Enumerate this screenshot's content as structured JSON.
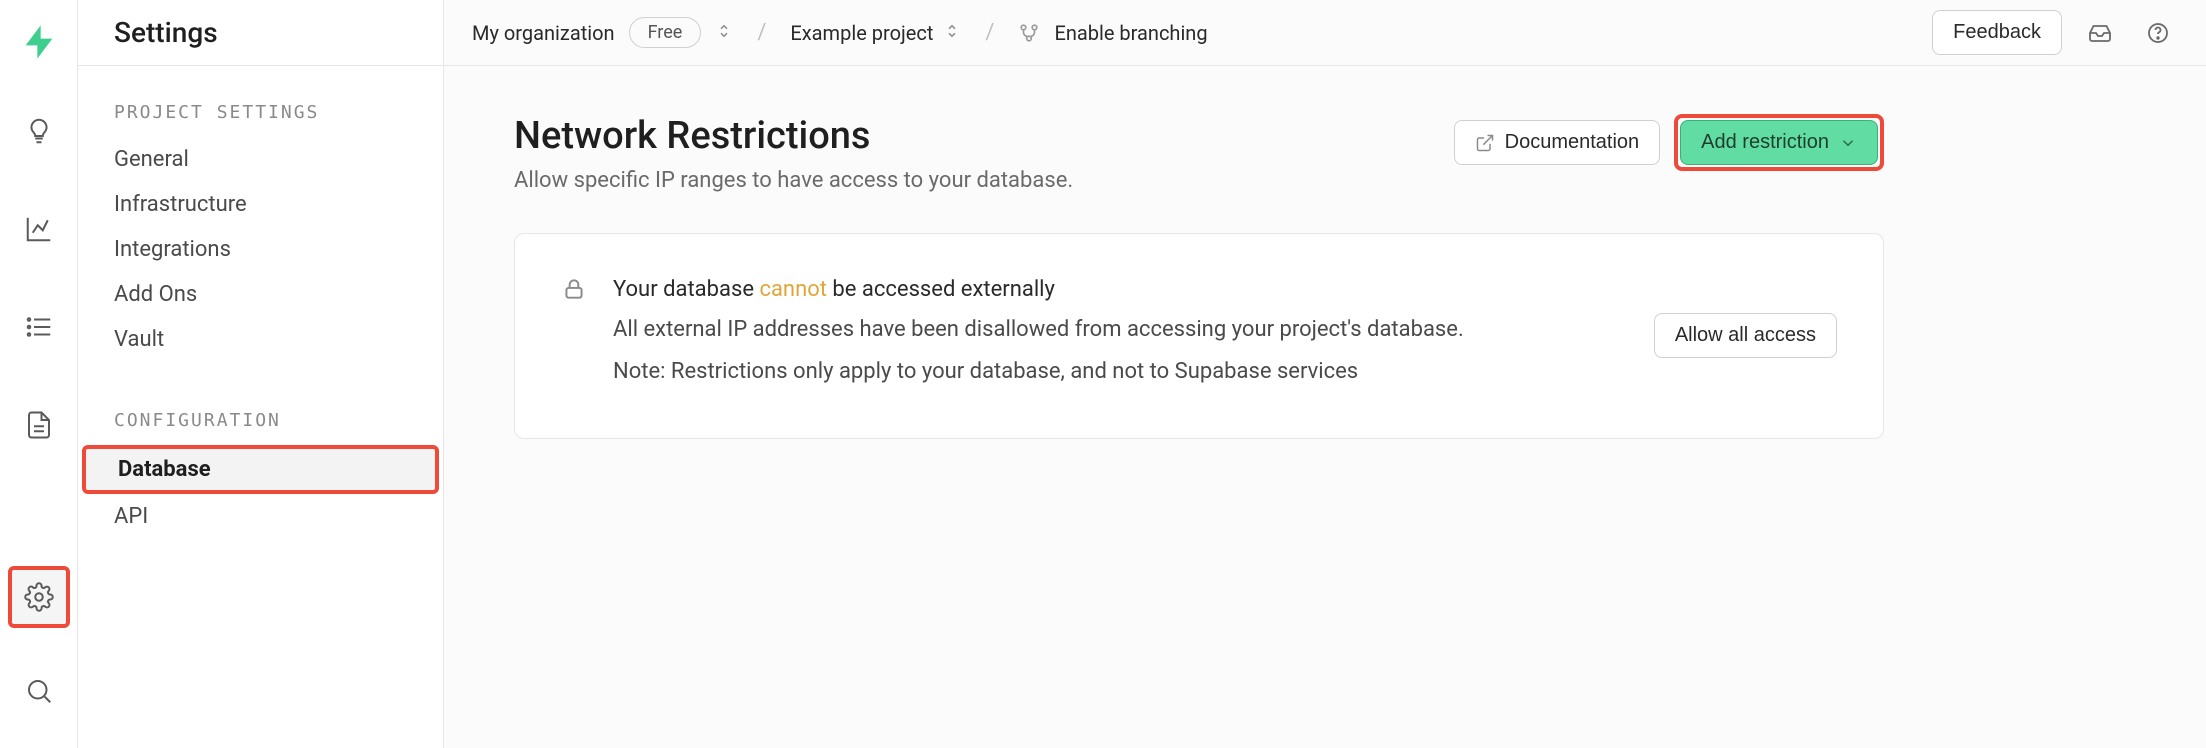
{
  "sidebar": {
    "title": "Settings",
    "groups": [
      {
        "title": "PROJECT SETTINGS",
        "items": [
          "General",
          "Infrastructure",
          "Integrations",
          "Add Ons",
          "Vault"
        ]
      },
      {
        "title": "CONFIGURATION",
        "items": [
          "Database",
          "API"
        ]
      }
    ]
  },
  "topbar": {
    "org": "My organization",
    "plan": "Free",
    "project": "Example project",
    "branching": "Enable branching",
    "feedback": "Feedback"
  },
  "section": {
    "title": "Network Restrictions",
    "subtitle": "Allow specific IP ranges to have access to your database.",
    "docs": "Documentation",
    "add": "Add restriction"
  },
  "card": {
    "headline_prefix": "Your database ",
    "headline_warn": "cannot",
    "headline_suffix": " be accessed externally",
    "body1": "All external IP addresses have been disallowed from accessing your project's database.",
    "body2": "Note: Restrictions only apply to your database, and not to Supabase services",
    "allow_all": "Allow all access"
  }
}
